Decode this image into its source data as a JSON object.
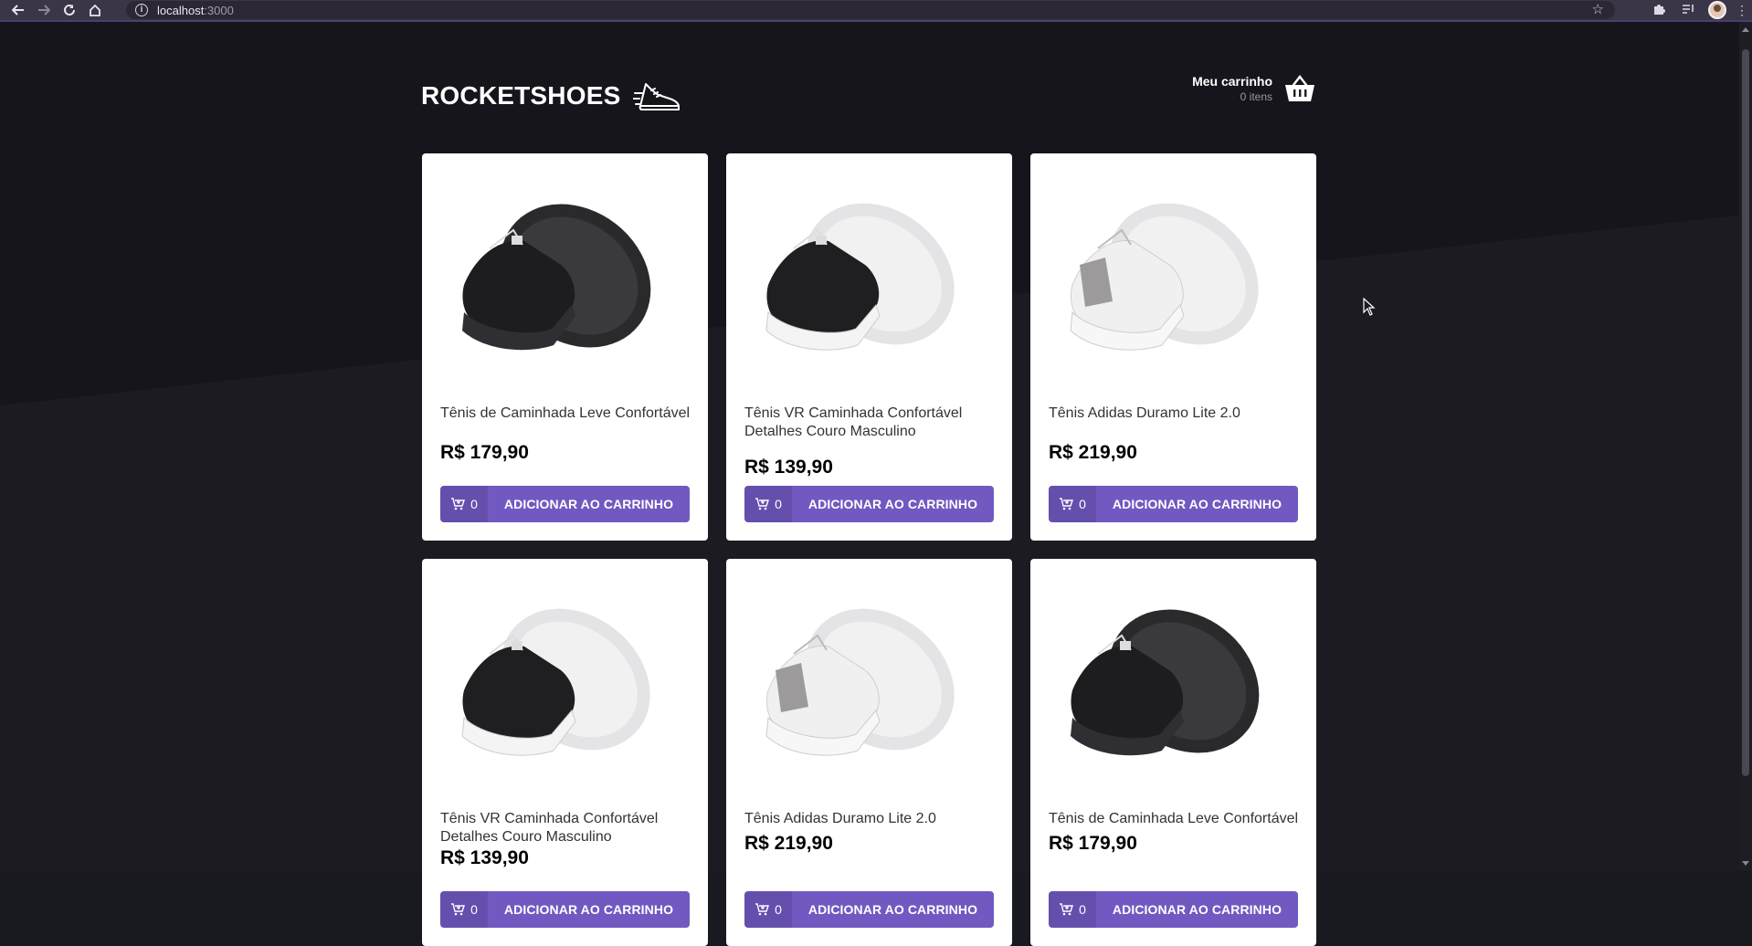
{
  "browser": {
    "url_host": "localhost",
    "url_port": ":3000",
    "back_icon": "arrow-left-icon",
    "forward_icon": "arrow-right-icon",
    "reload_icon": "reload-icon",
    "home_icon": "home-icon"
  },
  "header": {
    "logo": "ROCKETSHOES",
    "cart_title": "Meu carrinho",
    "cart_count": "0 itens"
  },
  "colors": {
    "accent": "#7159c1",
    "background": "#191920"
  },
  "products": [
    {
      "title": "Tênis de Caminhada Leve Confortável",
      "price": "R$ 179,90",
      "qty": "0",
      "button": "ADICIONAR AO CARRINHO",
      "shoe": "black"
    },
    {
      "title": "Tênis VR Caminhada Confortável Detalhes Couro Masculino",
      "price": "R$ 139,90",
      "qty": "0",
      "button": "ADICIONAR AO CARRINHO",
      "shoe": "black-white"
    },
    {
      "title": "Tênis Adidas Duramo Lite 2.0",
      "price": "R$ 219,90",
      "qty": "0",
      "button": "ADICIONAR AO CARRINHO",
      "shoe": "white"
    },
    {
      "title": "Tênis VR Caminhada Confortável Detalhes Couro Masculino",
      "price": "R$ 139,90",
      "qty": "0",
      "button": "ADICIONAR AO CARRINHO",
      "shoe": "black-white"
    },
    {
      "title": "Tênis Adidas Duramo Lite 2.0",
      "price": "R$ 219,90",
      "qty": "0",
      "button": "ADICIONAR AO CARRINHO",
      "shoe": "white"
    },
    {
      "title": "Tênis de Caminhada Leve Confortável",
      "price": "R$ 179,90",
      "qty": "0",
      "button": "ADICIONAR AO CARRINHO",
      "shoe": "black"
    }
  ]
}
